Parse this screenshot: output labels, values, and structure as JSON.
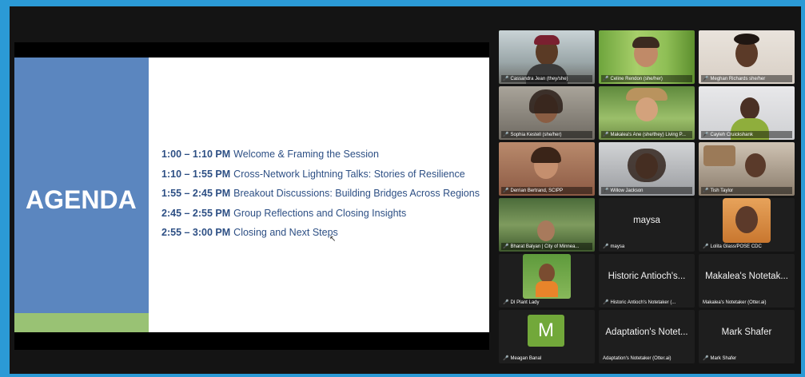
{
  "slide": {
    "title": "AGENDA",
    "items": [
      {
        "time": "1:00 – 1:10 PM",
        "text": "Welcome & Framing the Session"
      },
      {
        "time": "1:10 – 1:55 PM",
        "text": "Cross-Network Lightning Talks: Stories of Resilience"
      },
      {
        "time": "1:55 – 2:45 PM",
        "text": "Breakout Discussions: Building Bridges Across Regions"
      },
      {
        "time": "2:45 – 2:55 PM",
        "text": "Group Reflections and Closing Insights"
      },
      {
        "time": "2:55 – 3:00 PM",
        "text": "Closing and Next Steps"
      }
    ],
    "colors": {
      "blue": "#5b86bf",
      "green": "#99c274",
      "text": "#2d4f84"
    }
  },
  "participants": [
    {
      "name": "Cassandra Jean (they/she)",
      "type": "video"
    },
    {
      "name": "Celine Rendon (she/her)",
      "type": "video"
    },
    {
      "name": "Meghan Richards she/her",
      "type": "video"
    },
    {
      "name": "Sophia Kestell (she/her)",
      "type": "video"
    },
    {
      "name": "Makalea's Ane (she/they) Living P...",
      "type": "video"
    },
    {
      "name": "Cayleh Cruickshank",
      "type": "video"
    },
    {
      "name": "Derrian Bertrand, SCIPP",
      "type": "video"
    },
    {
      "name": "Willow Jackson",
      "type": "video"
    },
    {
      "name": "Tish Taylor",
      "type": "video"
    },
    {
      "name": "Bharat Balyan | City of Minnea...",
      "type": "video"
    },
    {
      "name": "maysa",
      "type": "name",
      "display": "maysa"
    },
    {
      "name": "Lolita Glass/POSE CDC",
      "type": "video"
    },
    {
      "name": "DI Plant Lady",
      "type": "video"
    },
    {
      "name": "Historic Antioch's Notetaker (...",
      "type": "name",
      "display": "Historic Antioch's..."
    },
    {
      "name": "Makalea's Notetaker (Otter.ai)",
      "type": "name",
      "display": "Makalea's Notetak..."
    },
    {
      "name": "Meagan Banal",
      "type": "avatar",
      "letter": "M"
    },
    {
      "name": "Adaptation's Notetaker (Otter.ai)",
      "type": "name",
      "display": "Adaptation's Notet..."
    },
    {
      "name": "Mark Shafer",
      "type": "name",
      "display": "Mark Shafer"
    }
  ],
  "colors": {
    "frame": "#2b9ad6",
    "active_speaker": "#3ea640",
    "mic_muted": "#e33333"
  }
}
